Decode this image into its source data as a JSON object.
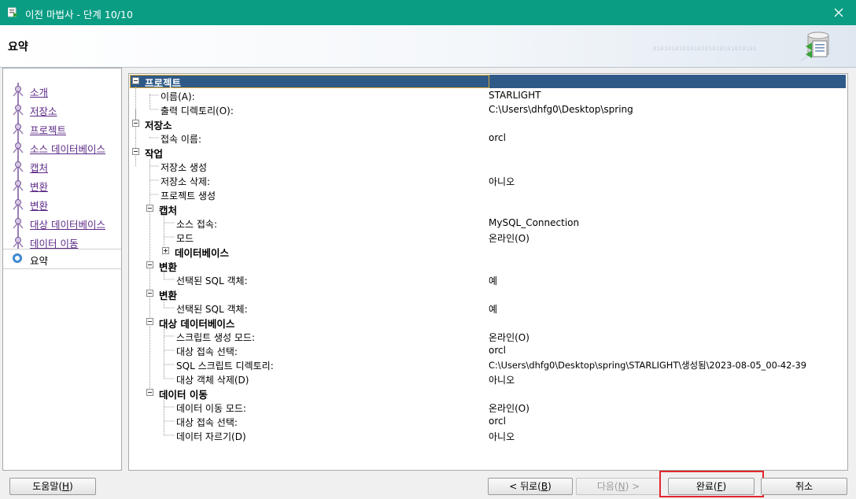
{
  "window": {
    "title": "이전 마법사 - 단계 10/10"
  },
  "header": {
    "title": "요약",
    "binary_text": "0101010101010101010101010101"
  },
  "nav": {
    "steps": [
      {
        "label": "소개",
        "state": "link"
      },
      {
        "label": "저장소",
        "state": "link"
      },
      {
        "label": "프로젝트",
        "state": "link"
      },
      {
        "label": "소스 데이터베이스",
        "state": "link"
      },
      {
        "label": "캡처",
        "state": "link"
      },
      {
        "label": "변환",
        "state": "link"
      },
      {
        "label": "변환",
        "state": "link"
      },
      {
        "label": "대상 데이터베이스",
        "state": "link"
      },
      {
        "label": "데이터 이동",
        "state": "link"
      },
      {
        "label": "요약",
        "state": "active"
      }
    ]
  },
  "summary": {
    "project": {
      "label": "프로젝트",
      "name_label": "이름(A):",
      "name_value": "STARLIGHT",
      "outdir_label": "출력 디렉토리(O):",
      "outdir_value": "C:\\Users\\dhfg0\\Desktop\\spring"
    },
    "repository": {
      "label": "저장소",
      "conn_label": "접속 이름:",
      "conn_value": "orcl"
    },
    "tasks": {
      "label": "작업",
      "create_repo": "저장소 생성",
      "delete_repo_label": "저장소 삭제:",
      "delete_repo_value": "아니오",
      "create_project": "프로젝트 생성",
      "capture": {
        "label": "캡처",
        "source_conn_label": "소스 접속:",
        "source_conn_value": "MySQL_Connection",
        "mode_label": "모드",
        "mode_value": "온라인(O)",
        "databases_label": "데이터베이스"
      },
      "convert1": {
        "label": "변환",
        "selected_label": "선택된 SQL 객체:",
        "selected_value": "예"
      },
      "convert2": {
        "label": "변환",
        "selected_label": "선택된 SQL 객체:",
        "selected_value": "예"
      },
      "target": {
        "label": "대상 데이터베이스",
        "script_mode_label": "스크립트 생성 모드:",
        "script_mode_value": "온라인(O)",
        "target_conn_label": "대상 접속 선택:",
        "target_conn_value": "orcl",
        "script_dir_label": "SQL 스크립트 디렉토리:",
        "script_dir_value": "C:\\Users\\dhfg0\\Desktop\\spring\\STARLIGHT\\생성됨\\2023-08-05_00-42-39",
        "drop_label": "대상 객체 삭제(D)",
        "drop_value": "아니오"
      },
      "data_move": {
        "label": "데이터 이동",
        "mode_label": "데이터 이동 모드:",
        "mode_value": "온라인(O)",
        "target_conn_label": "대상 접속 선택:",
        "target_conn_value": "orcl",
        "truncate_label": "데이터 자르기(D)",
        "truncate_value": "아니오"
      }
    }
  },
  "buttons": {
    "help_label": "도움말(",
    "help_key": "H",
    "help_close": ")",
    "back_label": "< 뒤로(",
    "back_key": "B",
    "back_close": ")",
    "next_label": "다음(",
    "next_key": "N",
    "next_close": ") >",
    "finish_label": "완료(",
    "finish_key": "F",
    "finish_close": ")",
    "cancel_label": "취소"
  },
  "colors": {
    "titlebar": "#0a9d84",
    "selection": "#2f5a88",
    "link": "#5c2a86",
    "highlight_box": "#e3262c"
  }
}
